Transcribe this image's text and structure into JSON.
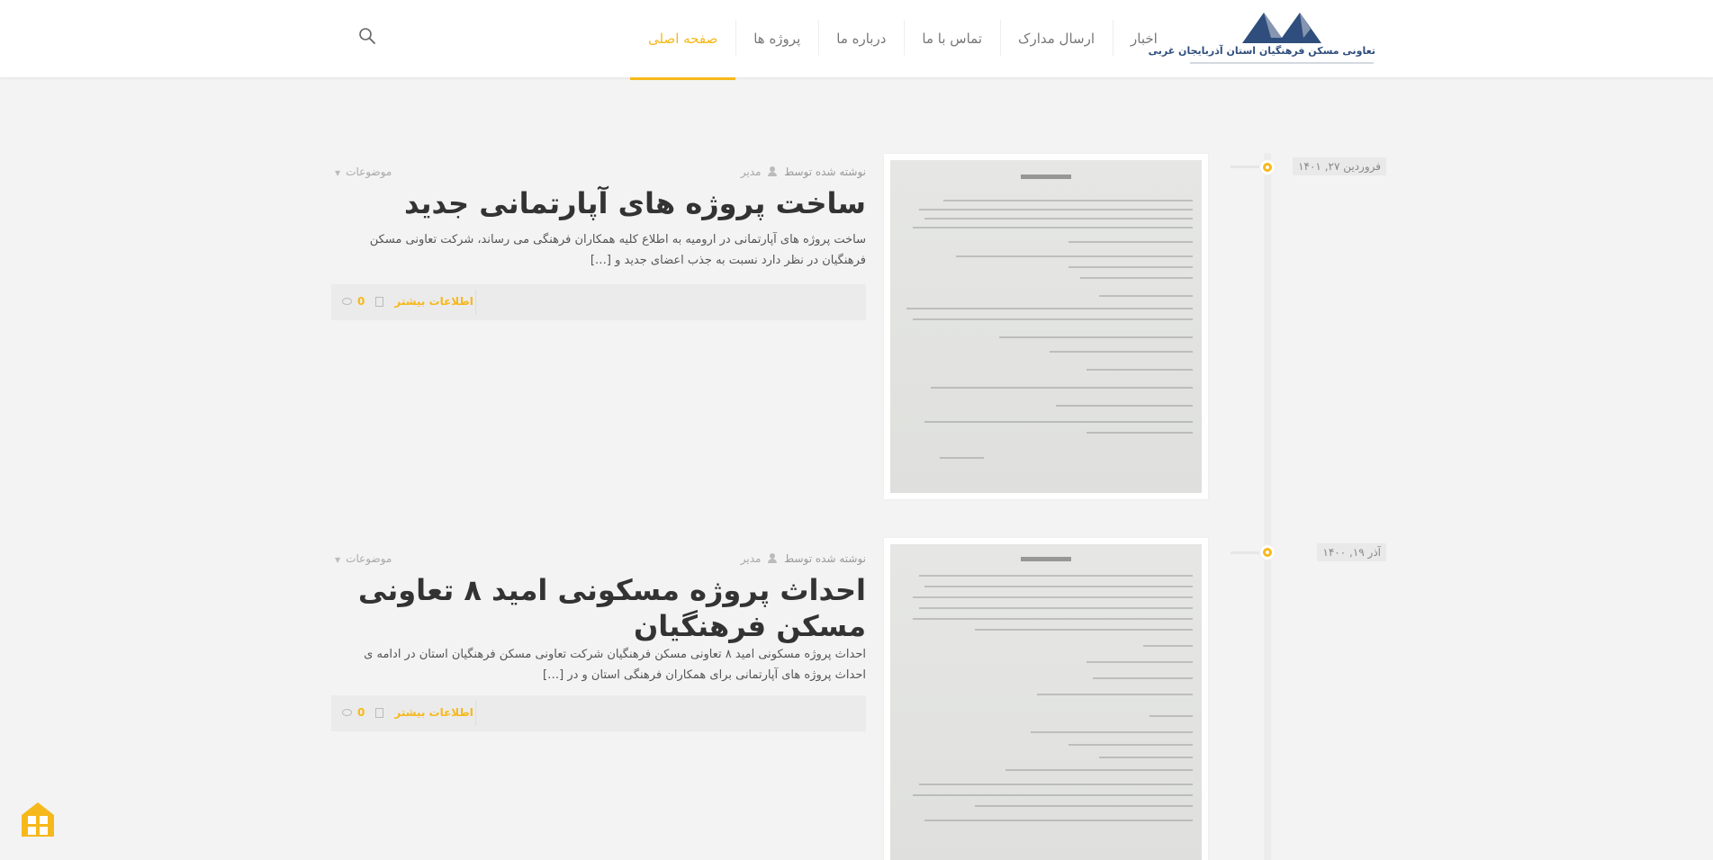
{
  "header": {
    "logo_text": "تعاونی مسکن فرهنگیان استان آذربایجان غربی",
    "nav": [
      {
        "label": "صفحه اصلی",
        "active": true
      },
      {
        "label": "پروژه ها",
        "active": false
      },
      {
        "label": "درباره ما",
        "active": false
      },
      {
        "label": "تماس با ما",
        "active": false
      },
      {
        "label": "ارسال مدارک",
        "active": false
      },
      {
        "label": "اخبار",
        "active": false
      }
    ]
  },
  "posts": [
    {
      "date": "فروردین ۲۷, ۱۴۰۱",
      "written_by": "نوشته شده توسط",
      "author": "مدیر",
      "categories": "موضوعات",
      "title": "ساخت پروژه های آپارتمانی جدید",
      "excerpt": "ساخت پروژه های آپارتمانی در ارومیه به اطلاع کلیه همکاران فرهنگی می رساند، شرکت تعاونی مسکن فرهنگیان در نظر دارد نسبت به جذب اعضای جدید و […]",
      "more_label": "اطلاعات بیشتر",
      "comments": "0"
    },
    {
      "date": "آذر ۱۹, ۱۴۰۰",
      "written_by": "نوشته شده توسط",
      "author": "مدیر",
      "categories": "موضوعات",
      "title": "احداث پروژه مسکونی امید ۸ تعاونی مسکن فرهنگیان",
      "excerpt": "احداث پروژه مسکونی امید ۸ تعاونی مسکن فرهنگیان شرکت تعاونی مسکن فرهنگیان استان در ادامه ی احداث پروژه های آپارتمانی برای همکاران فرهنگی استان و در […]",
      "more_label": "اطلاعات بیشتر",
      "comments": "0"
    }
  ],
  "colors": {
    "accent": "#f6b81b",
    "logo_blue": "#2f4e7d",
    "background": "#f3f3f3"
  }
}
